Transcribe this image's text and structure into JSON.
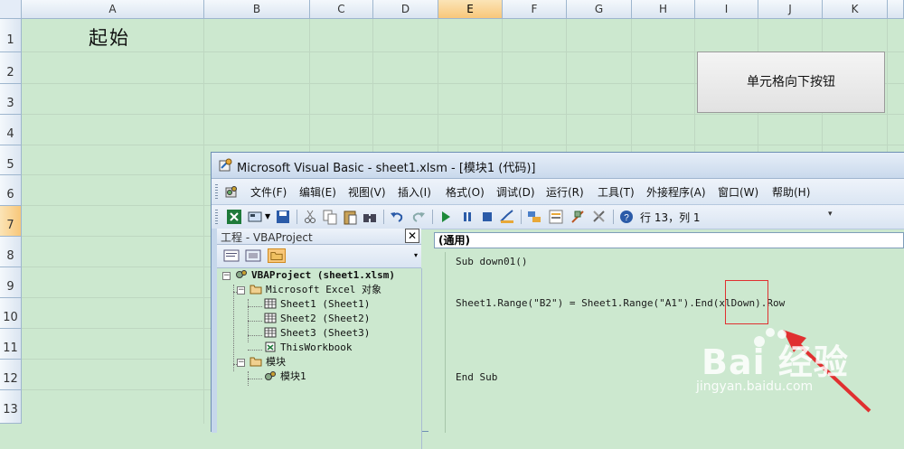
{
  "excel": {
    "columns": [
      "A",
      "B",
      "C",
      "D",
      "E",
      "F",
      "G",
      "H",
      "I",
      "J",
      "K"
    ],
    "rows": [
      "1",
      "2",
      "3",
      "4",
      "5",
      "6",
      "7",
      "8",
      "9",
      "10",
      "11",
      "12",
      "13"
    ],
    "selected_column": "E",
    "selected_row": "7",
    "cell_a1_text": "起始",
    "button_label": "单元格向下按钮"
  },
  "vbe": {
    "title": "Microsoft Visual Basic - sheet1.xlsm - [模块1 (代码)]",
    "menu": [
      "文件(F)",
      "编辑(E)",
      "视图(V)",
      "插入(I)",
      "格式(O)",
      "调试(D)",
      "运行(R)",
      "工具(T)",
      "外接程序(A)",
      "窗口(W)",
      "帮助(H)"
    ],
    "cursor_position": "行 13，列 1",
    "project_panel": {
      "title": "工程 - VBAProject",
      "close_glyph": "✕",
      "tree": {
        "root": "VBAProject (sheet1.xlsm)",
        "excel_objects_folder": "Microsoft Excel 对象",
        "sheets": [
          "Sheet1 (Sheet1)",
          "Sheet2 (Sheet2)",
          "Sheet3 (Sheet3)"
        ],
        "workbook": "ThisWorkbook",
        "modules_folder": "模块",
        "module": "模块1"
      }
    },
    "code": {
      "procedure_combo": "(通用)",
      "lines": [
        "Sub down01()",
        "Sheet1.Range(\"B2\") = Sheet1.Range(\"A1\").End(xlDown).Row",
        "End Sub"
      ]
    }
  },
  "watermark": {
    "brand": "Bai 经验",
    "domain": "jingyan.baidu.com"
  },
  "colors": {
    "sheet_background": "#cce8cf",
    "selected_header": "#f8c77a",
    "highlight_red": "#e03030"
  }
}
